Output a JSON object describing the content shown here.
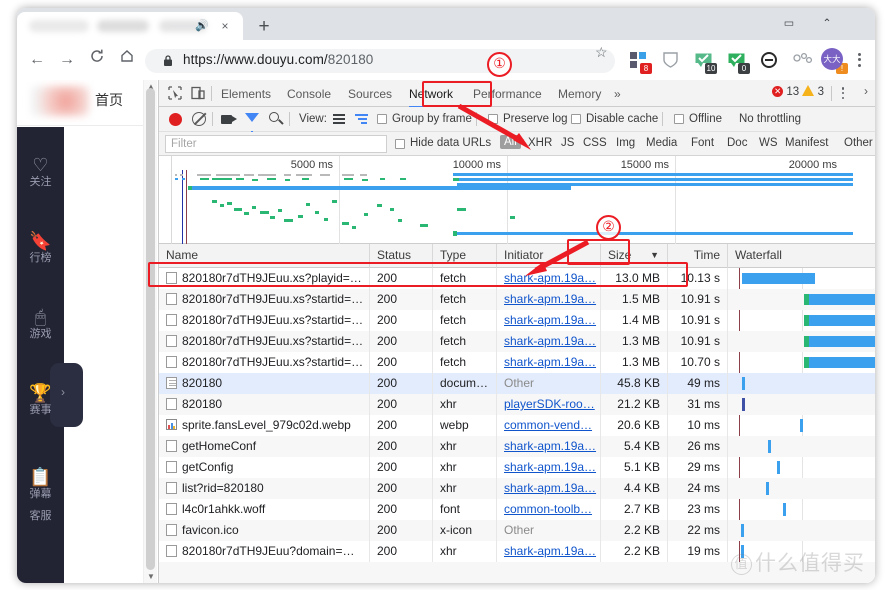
{
  "browser": {
    "tab": {
      "audio_icon": "speaker-icon",
      "close_icon": "×",
      "newtab_icon": "+"
    },
    "window_controls": {
      "minimize": "—",
      "maximize": "▭",
      "close": "✕"
    },
    "nav": {
      "back": "←",
      "forward": "→",
      "reload": "C",
      "home": "⌂"
    },
    "omnibox": {
      "lock_icon": "🔒",
      "url_scheme": "https://www.douyu.com/",
      "url_path": "820180",
      "star_icon": "☆"
    },
    "extensions": [
      {
        "name": "blocks-extension",
        "badge": "8",
        "badge_color": "#e02020"
      },
      {
        "name": "shield-extension",
        "badge": "",
        "badge_color": ""
      },
      {
        "name": "check-grey-extension",
        "badge": "10",
        "badge_color": "#3c4043"
      },
      {
        "name": "check-green-extension",
        "badge": "0",
        "badge_color": "#3c4043"
      },
      {
        "name": "link-extension",
        "badge": "",
        "badge_color": ""
      },
      {
        "name": "molecule-extension",
        "badge": "",
        "badge_color": ""
      },
      {
        "name": "drop-extension",
        "badge": "!",
        "badge_color": "#ef8c1f"
      }
    ],
    "avatar_label": "大大",
    "menu_icon": "kebab-menu-icon"
  },
  "site": {
    "home_label": "首页",
    "nav_items": [
      {
        "icon": "heart-icon",
        "label": "关注"
      },
      {
        "icon": "bookmark-star-icon",
        "label": "行榜"
      },
      {
        "icon": "game-icon",
        "label": "游戏"
      },
      {
        "icon": "trophy-icon",
        "label": "赛事"
      },
      {
        "icon": "list-icon",
        "label": "弹幕"
      },
      {
        "icon": "support-icon",
        "label": "客服"
      }
    ],
    "chevron": "›"
  },
  "devtools": {
    "tabs": [
      {
        "label": "Elements",
        "selected": false
      },
      {
        "label": "Console",
        "selected": false
      },
      {
        "label": "Sources",
        "selected": false
      },
      {
        "label": "Network",
        "selected": true
      },
      {
        "label": "Performance",
        "selected": false
      },
      {
        "label": "Memory",
        "selected": false
      },
      {
        "label": "»",
        "selected": false
      }
    ],
    "error_count": "13",
    "warning_count": "3",
    "more_icon": "›",
    "toolbar": {
      "record_icon": "record-icon",
      "clear_icon": "clear-icon",
      "screenshot_icon": "camera-icon",
      "filter_icon": "funnel-icon",
      "search_icon": "search-icon",
      "view_label": "View:",
      "list_view_icon": "list-view-icon",
      "waterfall_view_icon": "waterfall-view-icon",
      "group_by_frame": "Group by frame",
      "preserve_log": "Preserve log",
      "disable_cache": "Disable cache",
      "offline": "Offline",
      "throttling": "No throttling"
    },
    "filter_row": {
      "placeholder": "Filter",
      "hide_data_urls": "Hide data URLs",
      "types": [
        "All",
        "XHR",
        "JS",
        "CSS",
        "Img",
        "Media",
        "Font",
        "Doc",
        "WS",
        "Manifest",
        "Other"
      ],
      "active_type": "All"
    },
    "overview": {
      "ticks": [
        "5000 ms",
        "10000 ms",
        "15000 ms",
        "20000 ms"
      ]
    },
    "columns": [
      "Name",
      "Status",
      "Type",
      "Initiator",
      "Size",
      "Time",
      "Waterfall"
    ],
    "sort_column": "Size",
    "sort_arrow": "▼",
    "rows": [
      {
        "name": "820180r7dTH9JEuu.xs?playid=…",
        "status": "200",
        "type": "fetch",
        "initiator": "shark-apm.19a…",
        "size": "13.0 MB",
        "time": "10.13 s",
        "icon": "checkbox-icon"
      },
      {
        "name": "820180r7dTH9JEuu.xs?startid=…",
        "status": "200",
        "type": "fetch",
        "initiator": "shark-apm.19a…",
        "size": "1.5 MB",
        "time": "10.91 s",
        "icon": "checkbox-icon"
      },
      {
        "name": "820180r7dTH9JEuu.xs?startid=…",
        "status": "200",
        "type": "fetch",
        "initiator": "shark-apm.19a…",
        "size": "1.4 MB",
        "time": "10.91 s",
        "icon": "checkbox-icon"
      },
      {
        "name": "820180r7dTH9JEuu.xs?startid=…",
        "status": "200",
        "type": "fetch",
        "initiator": "shark-apm.19a…",
        "size": "1.3 MB",
        "time": "10.91 s",
        "icon": "checkbox-icon"
      },
      {
        "name": "820180r7dTH9JEuu.xs?startid=…",
        "status": "200",
        "type": "fetch",
        "initiator": "shark-apm.19a…",
        "size": "1.3 MB",
        "time": "10.70 s",
        "icon": "checkbox-icon"
      },
      {
        "name": "820180",
        "status": "200",
        "type": "docum…",
        "initiator": "Other",
        "size": "45.8 KB",
        "time": "49 ms",
        "icon": "document-icon"
      },
      {
        "name": "820180",
        "status": "200",
        "type": "xhr",
        "initiator": "playerSDK-roo…",
        "size": "21.2 KB",
        "time": "31 ms",
        "icon": "checkbox-icon"
      },
      {
        "name": "sprite.fansLevel_979c02d.webp",
        "status": "200",
        "type": "webp",
        "initiator": "common-vend…",
        "size": "20.6 KB",
        "time": "10 ms",
        "icon": "image-icon"
      },
      {
        "name": "getHomeConf",
        "status": "200",
        "type": "xhr",
        "initiator": "shark-apm.19a…",
        "size": "5.4 KB",
        "time": "26 ms",
        "icon": "checkbox-icon"
      },
      {
        "name": "getConfig",
        "status": "200",
        "type": "xhr",
        "initiator": "shark-apm.19a…",
        "size": "5.1 KB",
        "time": "29 ms",
        "icon": "checkbox-icon"
      },
      {
        "name": "list?rid=820180",
        "status": "200",
        "type": "xhr",
        "initiator": "shark-apm.19a…",
        "size": "4.4 KB",
        "time": "24 ms",
        "icon": "checkbox-icon"
      },
      {
        "name": "l4c0r1ahkk.woff",
        "status": "200",
        "type": "font",
        "initiator": "common-toolb…",
        "size": "2.7 KB",
        "time": "23 ms",
        "icon": "checkbox-icon"
      },
      {
        "name": "favicon.ico",
        "status": "200",
        "type": "x-icon",
        "initiator": "Other",
        "size": "2.2 KB",
        "time": "22 ms",
        "icon": "checkbox-icon"
      },
      {
        "name": "820180r7dTH9JEuu?domain=…",
        "status": "200",
        "type": "xhr",
        "initiator": "shark-apm.19a…",
        "size": "2.2 KB",
        "time": "19 ms",
        "icon": "checkbox-icon"
      }
    ]
  },
  "annotations": {
    "marker_1": "①",
    "marker_2": "②",
    "accent_color": "#ec1c24"
  },
  "watermark": {
    "circle": "值",
    "text": "什么值得买"
  }
}
